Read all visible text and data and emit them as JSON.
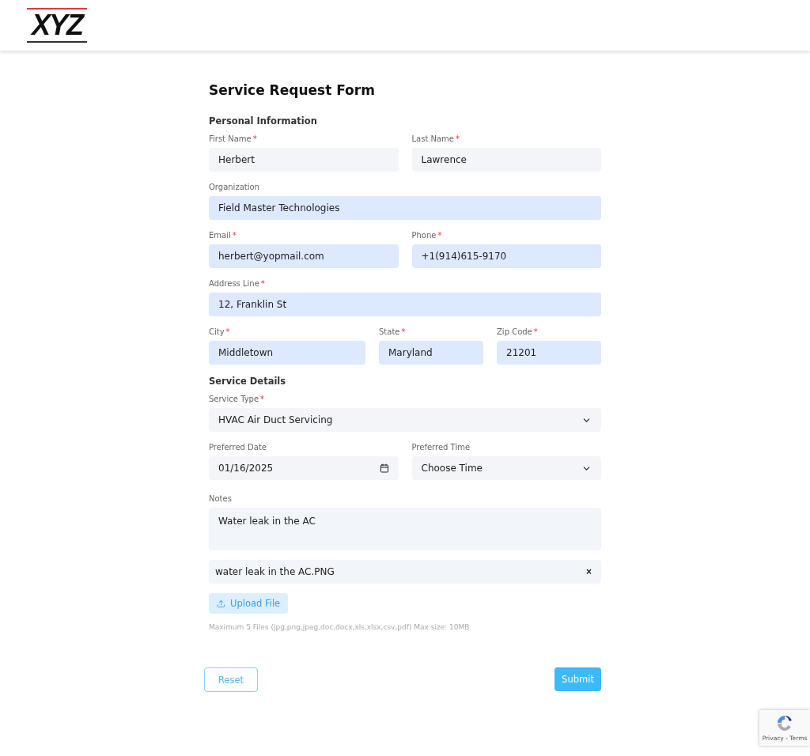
{
  "logo": {
    "text": "XYZ"
  },
  "form": {
    "title": "Service Request Form",
    "sections": [
      {
        "heading": "Personal Information",
        "rows": [
          [
            {
              "label": "First Name",
              "required": true,
              "kind": "text",
              "value": "Herbert",
              "autofilled": false
            },
            {
              "label": "Last Name",
              "required": true,
              "kind": "text",
              "value": "Lawrence",
              "autofilled": false
            }
          ],
          [
            {
              "label": "Organization",
              "required": false,
              "kind": "text",
              "value": "Field Master Technologies",
              "autofilled": true
            }
          ],
          [
            {
              "label": "Email",
              "required": true,
              "kind": "text",
              "value": "herbert@yopmail.com",
              "autofilled": true
            },
            {
              "label": "Phone",
              "required": true,
              "kind": "text",
              "value": "+1(914)615-9170",
              "autofilled": true
            }
          ],
          [
            {
              "label": "Address Line",
              "required": true,
              "kind": "text",
              "value": "12, Franklin St",
              "autofilled": true
            }
          ],
          [
            {
              "label": "City",
              "required": true,
              "kind": "text",
              "value": "Middletown",
              "autofilled": true
            },
            {
              "label": "State",
              "required": true,
              "kind": "text",
              "value": "Maryland",
              "autofilled": true
            },
            {
              "label": "Zip Code",
              "required": true,
              "kind": "text",
              "value": "21201",
              "autofilled": true
            }
          ]
        ]
      },
      {
        "heading": "Service Details",
        "rows": [
          [
            {
              "label": "Service Type",
              "required": true,
              "kind": "select",
              "value": "HVAC Air Duct Servicing",
              "autofilled": false
            }
          ],
          [
            {
              "label": "Preferred Date",
              "required": false,
              "kind": "date",
              "value": "01/16/2025",
              "autofilled": false
            },
            {
              "label": "Preferred Time",
              "required": false,
              "kind": "select",
              "value": "Choose Time",
              "autofilled": false
            }
          ]
        ]
      }
    ],
    "required_mark": "*",
    "notes": {
      "label": "Notes",
      "value": "Water leak in the AC"
    },
    "attachment": {
      "name": "water leak in the AC.PNG",
      "remove": "×"
    },
    "upload": {
      "label": "Upload File",
      "hint": "Maximum 5 Files (jpg,png,jpeg,doc,docx,xls,xlsx,csv,pdf) Max size: 10MB"
    },
    "buttons": {
      "reset": "Reset",
      "submit": "Submit"
    }
  },
  "recaptcha": {
    "links": "Privacy - Terms"
  }
}
